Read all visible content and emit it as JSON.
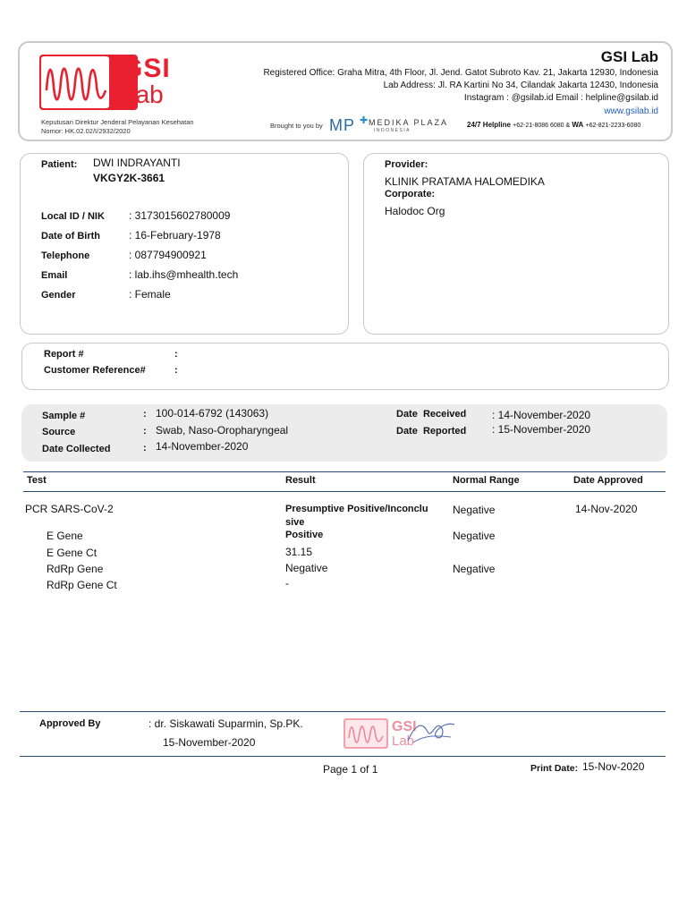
{
  "header": {
    "brand_title": "GSI Lab",
    "logo_text_1": "GSI",
    "logo_text_2": "Lab",
    "registered_office": "Registered Office: Graha Mitra, 4th Floor, Jl. Jend. Gatot Subroto Kav. 21, Jakarta 12930, Indonesia",
    "lab_address": "Lab Address: Jl. RA Kartini No 34, Cilandak Jakarta 12430, Indonesia",
    "contact": "Instagram : @gsilab.id Email : helpline@gsilab.id",
    "website": "www.gsilab.id",
    "decree_1": "Keputusan Direktur Jenderal Pelayanan Kesehatan",
    "decree_2": "Nomor: HK.02.02/I/2932/2020",
    "brought_by": "Brought to you by",
    "partner_mp": "MP",
    "partner_name": "MEDIKA PLAZA",
    "partner_sub": "INDONESIA",
    "helpline_label": "24/7 Helpline",
    "helpline_number": "+62-21-8086 6080 &",
    "wa_label": "WA",
    "wa_number": "+62-821-2233-6080",
    "brand_color": "#e8202f",
    "link_color": "#1f5fbf"
  },
  "patient": {
    "label": "Patient:",
    "name": "DWI INDRAYANTI",
    "code": "VKGY2K-3661",
    "fields": [
      {
        "label": "Local ID / NIK",
        "value": ": 3173015602780009"
      },
      {
        "label": "Date of Birth",
        "value": ": 16-February-1978"
      },
      {
        "label": "Telephone",
        "value": ": 087794900921"
      },
      {
        "label": "Email",
        "value": ": lab.ihs@mhealth.tech"
      },
      {
        "label": "Gender",
        "value": ": Female"
      }
    ]
  },
  "provider": {
    "label": "Provider:",
    "name": "KLINIK PRATAMA HALOMEDIKA",
    "corporate_label": "Corporate:",
    "corporate": "Halodoc Org"
  },
  "report": {
    "report_label": "Report #",
    "report_value": ":",
    "ref_label": "Customer Reference#",
    "ref_value": ":"
  },
  "sample": {
    "left": [
      {
        "label": "Sample #",
        "colon": ":",
        "value": "100-014-6792 (143063)"
      },
      {
        "label": "Source",
        "colon": ":",
        "value": "Swab, Naso-Oropharyngeal"
      },
      {
        "label": "Date Collected",
        "colon": ":",
        "value": "14-November-2020"
      }
    ],
    "right": [
      {
        "label": "Date  Received",
        "value": ": 14-November-2020"
      },
      {
        "label": "Date  Reported",
        "value": ": 15-November-2020"
      }
    ]
  },
  "results": {
    "headers": [
      "Test",
      "Result",
      "Normal Range",
      "Date Approved"
    ],
    "main_test": "PCR SARS-CoV-2",
    "main_result_1": "Presumptive Positive/Inconclu",
    "main_result_2": "sive",
    "main_range": "Negative",
    "main_date": "14-Nov-2020",
    "sub_rows": [
      {
        "test": "E Gene",
        "result": "Positive",
        "bold": true,
        "range": "Negative"
      },
      {
        "test": "E Gene Ct",
        "result": "31.15",
        "bold": false,
        "range": ""
      },
      {
        "test": "RdRp Gene",
        "result": "Negative",
        "bold": false,
        "range": "Negative"
      },
      {
        "test": "RdRp Gene Ct",
        "result": "-",
        "bold": false,
        "range": ""
      }
    ]
  },
  "approval": {
    "label": "Approved By",
    "name": ": dr. Siskawati Suparmin, Sp.PK.",
    "date": "15-November-2020",
    "stamp_1": "GSI",
    "stamp_2": "Lab"
  },
  "footer": {
    "page": "Page 1 of 1",
    "print_label": "Print Date:",
    "print_value": "15-Nov-2020"
  }
}
